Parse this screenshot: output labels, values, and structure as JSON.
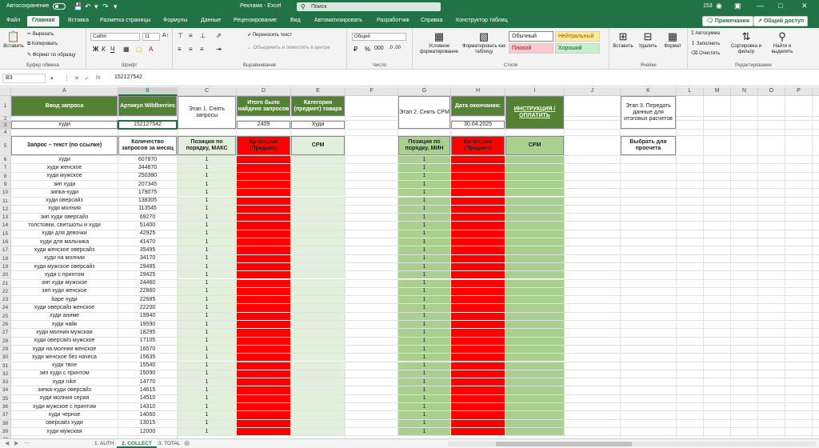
{
  "app": {
    "autosave_label": "Автосохранение",
    "title": "Реклама  -  Excel",
    "search_placeholder": "Поиск",
    "count": "153",
    "comments_label": "Примечания",
    "share_label": "Общий доступ"
  },
  "menu": [
    "Файл",
    "Главная",
    "Вставка",
    "Разметка страницы",
    "Формулы",
    "Данные",
    "Рецензирование",
    "Вид",
    "Автоматизировать",
    "Разработчик",
    "Справка",
    "Конструктор таблиц"
  ],
  "ribbon": {
    "clipboard": {
      "paste": "Вставить",
      "cut": "Вырезать",
      "copy": "Копировать",
      "format_painter": "Формат по образцу",
      "label": "Буфер обмена"
    },
    "font": {
      "name": "Calibri",
      "size": "11",
      "label": "Шрифт"
    },
    "align": {
      "wrap": "Переносить текст",
      "merge": "Объединить и поместить в центре",
      "label": "Выравнивание"
    },
    "number": {
      "format": "Общий",
      "label": "Число"
    },
    "styles": {
      "cond": "Условное форматирование",
      "as_table": "Форматировать как таблицу",
      "normal": "Обычный",
      "neutral": "Нейтральный",
      "bad": "Плохой",
      "good": "Хороший",
      "label": "Стили"
    },
    "cells": {
      "insert": "Вставить",
      "delete": "Удалить",
      "format": "Формат",
      "label": "Ячейки"
    },
    "editing": {
      "autosum": "Автосумма",
      "fill": "Заполнить",
      "clear": "Очистить",
      "sort": "Сортировка и фильтр",
      "find": "Найти и выделить",
      "label": "Редактирование"
    }
  },
  "formula": {
    "namebox": "B3",
    "value": "152127542"
  },
  "columns": [
    "A",
    "B",
    "C",
    "D",
    "E",
    "F",
    "G",
    "H",
    "I",
    "J",
    "K",
    "L",
    "M",
    "N",
    "O",
    "P",
    "Q",
    "R",
    "S",
    "T"
  ],
  "row_numbers": [
    "1",
    "2",
    "3",
    "4",
    "5",
    "6",
    "7",
    "8",
    "9",
    "10",
    "11",
    "12",
    "13",
    "14",
    "15",
    "16",
    "17",
    "18",
    "19",
    "20",
    "21",
    "22",
    "23",
    "24",
    "25",
    "26",
    "27",
    "28",
    "29",
    "30",
    "31",
    "32",
    "33",
    "34",
    "35",
    "36",
    "37",
    "38",
    "39",
    "40"
  ],
  "table": {
    "a1": "Ввод запроса",
    "b1": "Артикул Wildberries",
    "c1": "Этап 1. Снять запросы",
    "d1": "Итого было найдено запросов",
    "e1": "Категория (предмет) товара",
    "g1": "Этап 2. Снять CPM",
    "h1": "Дата окончания:",
    "i1": "ИНСТРУКЦИЯ / ОПЛАТИТЬ",
    "k1": "Этап 3. Передать данные для итоговых расчетов",
    "a3": "худи",
    "b3": "152127542",
    "d3": "2409",
    "e3": "Худи",
    "h3": "30.04.2025",
    "a5": "Запрос – текст (по ссылке)",
    "b5": "Количество запросов за месяц",
    "c5": "Позиция по порядку, МАКС",
    "d5": "Категория (Предмет)",
    "e5": "CPM",
    "g5": "Позиция по порядку, МИН",
    "h5": "Категория (Предмет)",
    "i5": "CPM",
    "k5": "Выбрать для просчета"
  },
  "rows": [
    {
      "q": "худи",
      "n": "607870",
      "c": "1",
      "g": "1"
    },
    {
      "q": "худи женское",
      "n": "344870",
      "c": "1",
      "g": "1"
    },
    {
      "q": "худи мужское",
      "n": "250380",
      "c": "1",
      "g": "1"
    },
    {
      "q": "зип худи",
      "n": "207345",
      "c": "1",
      "g": "1"
    },
    {
      "q": "зипка-худи",
      "n": "179075",
      "c": "1",
      "g": "1"
    },
    {
      "q": "худи оверсайз",
      "n": "138305",
      "c": "1",
      "g": "1"
    },
    {
      "q": "худи молния",
      "n": "113545",
      "c": "1",
      "g": "1"
    },
    {
      "q": "зип худи оверсайз",
      "n": "69270",
      "c": "1",
      "g": "1"
    },
    {
      "q": "толстовки, свитшоты и худи",
      "n": "51400",
      "c": "1",
      "g": "1"
    },
    {
      "q": "худи для девочки",
      "n": "42925",
      "c": "1",
      "g": "1"
    },
    {
      "q": "худи для мальчика",
      "n": "41470",
      "c": "1",
      "g": "1"
    },
    {
      "q": "худи женское оверсайз",
      "n": "35495",
      "c": "1",
      "g": "1"
    },
    {
      "q": "худи на молнии",
      "n": "34170",
      "c": "1",
      "g": "1"
    },
    {
      "q": "худи мужское оверсайз",
      "n": "29495",
      "c": "1",
      "g": "1"
    },
    {
      "q": "худи с принтом",
      "n": "29425",
      "c": "1",
      "g": "1"
    },
    {
      "q": "зип худи мужское",
      "n": "24460",
      "c": "1",
      "g": "1"
    },
    {
      "q": "зип худи женское",
      "n": "22860",
      "c": "1",
      "g": "1"
    },
    {
      "q": "bape худи",
      "n": "22685",
      "c": "1",
      "g": "1"
    },
    {
      "q": "худи оверсайз женское",
      "n": "22200",
      "c": "1",
      "g": "1"
    },
    {
      "q": "худи аниме",
      "n": "19940",
      "c": "1",
      "g": "1"
    },
    {
      "q": "худи найк",
      "n": "19590",
      "c": "1",
      "g": "1"
    },
    {
      "q": "худи молния мужская",
      "n": "18295",
      "c": "1",
      "g": "1"
    },
    {
      "q": "худи оверсайз мужское",
      "n": "17105",
      "c": "1",
      "g": "1"
    },
    {
      "q": "худи на молнии женское",
      "n": "16570",
      "c": "1",
      "g": "1"
    },
    {
      "q": "худи женское без начеса",
      "n": "15635",
      "c": "1",
      "g": "1"
    },
    {
      "q": "худи твое",
      "n": "15540",
      "c": "1",
      "g": "1"
    },
    {
      "q": "зип худи с принтом",
      "n": "15090",
      "c": "1",
      "g": "1"
    },
    {
      "q": "худи nike",
      "n": "14770",
      "c": "1",
      "g": "1"
    },
    {
      "q": "зипка-худи оверсайз",
      "n": "14615",
      "c": "1",
      "g": "1"
    },
    {
      "q": "худи молния серая",
      "n": "14510",
      "c": "1",
      "g": "1"
    },
    {
      "q": "худи мужское с принтом",
      "n": "14310",
      "c": "1",
      "g": "1"
    },
    {
      "q": "худи черное",
      "n": "14060",
      "c": "1",
      "g": "1"
    },
    {
      "q": "оверсайз худи",
      "n": "13015",
      "c": "1",
      "g": "1"
    },
    {
      "q": "худи мужская",
      "n": "12000",
      "c": "1",
      "g": "1"
    }
  ],
  "sheets": [
    "1. AUTH",
    "2. COLLECT",
    "3. TOTAL"
  ],
  "colors": {
    "accent": "#217346",
    "header_dark": "#548235",
    "light_green": "#e2efda",
    "mid_green": "#a9d08e",
    "red": "#ff0000"
  }
}
